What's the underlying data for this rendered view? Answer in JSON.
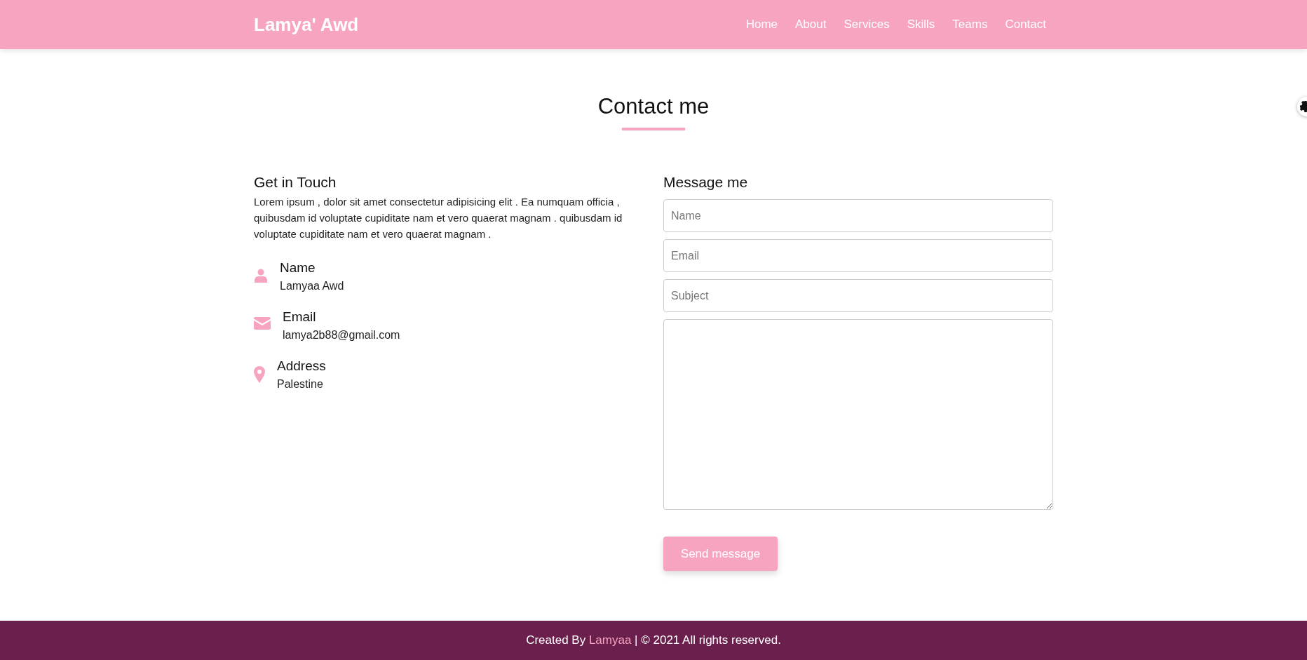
{
  "navbar": {
    "brand": "Lamya' Awd",
    "links": [
      {
        "label": "Home"
      },
      {
        "label": "About"
      },
      {
        "label": "Services"
      },
      {
        "label": "Skills"
      },
      {
        "label": "Teams"
      },
      {
        "label": "Contact"
      }
    ]
  },
  "section_title": "Contact me",
  "info": {
    "heading": "Get in Touch",
    "text": "Lorem ipsum , dolor sit amet consectetur adipisicing elit . Ea numquam officia , quibusdam id voluptate cupiditate nam et vero quaerat magnam . quibusdam id voluptate cupiditate nam et vero quaerat magnam .",
    "items": [
      {
        "kind": "person",
        "label": "Name",
        "value": "Lamyaa Awd"
      },
      {
        "kind": "mail",
        "label": "Email",
        "value": "lamya2b88@gmail.com"
      },
      {
        "kind": "pin",
        "label": "Address",
        "value": "Palestine"
      }
    ]
  },
  "form": {
    "heading": "Message me",
    "fields": [
      {
        "placeholder": "Name"
      },
      {
        "placeholder": "Email"
      },
      {
        "placeholder": "Subject"
      }
    ],
    "button": "Send message"
  },
  "footer": {
    "before": "Created By",
    "author": "Lamyaa",
    "after": "| © 2021 All rights reserved."
  }
}
